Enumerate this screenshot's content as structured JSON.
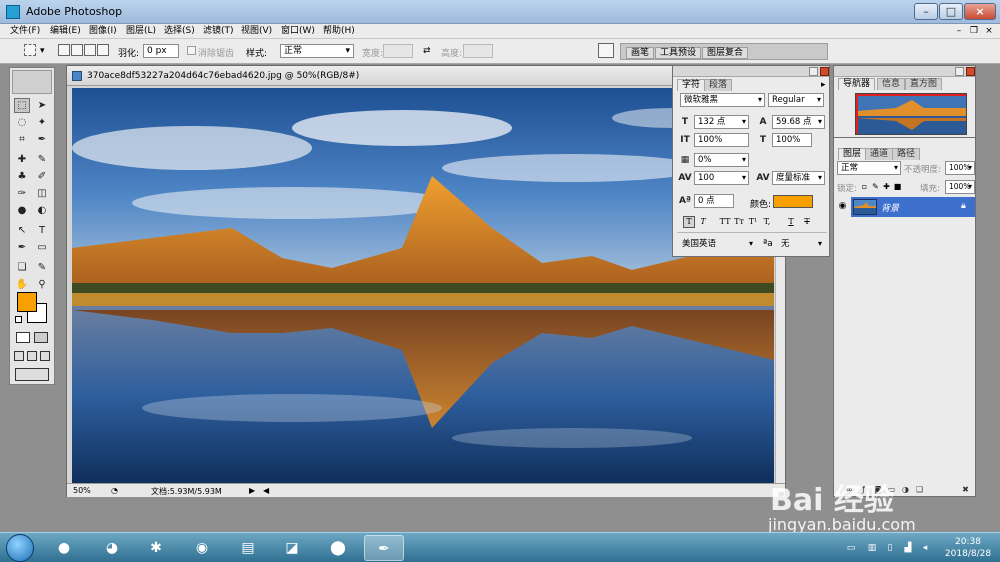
{
  "window": {
    "title": "Adobe Photoshop",
    "min": "–",
    "max": "□",
    "close": "×"
  },
  "menu": [
    "文件(F)",
    "编辑(E)",
    "图像(I)",
    "图层(L)",
    "选择(S)",
    "滤镜(T)",
    "视图(V)",
    "窗口(W)",
    "帮助(H)"
  ],
  "doc_controls": {
    "min": "–",
    "restore": "❐",
    "close": "×"
  },
  "options": {
    "feather_label": "羽化:",
    "feather_value": "0 px",
    "antialias_label": "消除锯齿",
    "style_label": "样式:",
    "style_value": "正常",
    "width_label": "宽度:",
    "height_label": "高度:",
    "swap": "⇄",
    "well_tabs": [
      "画笔",
      "工具预设",
      "图层复合"
    ]
  },
  "toolbox": {
    "tools": [
      "⬚",
      "➤",
      "◌",
      "✦",
      "⌗",
      "✒",
      "✚",
      "✎",
      "♣",
      "✐",
      "✑",
      "✎",
      "◫",
      "▮",
      "●",
      "◐",
      "↖",
      "T",
      "✒",
      "▭",
      "❏",
      "✋",
      "✋",
      "⚲"
    ],
    "fg_color": "#f7a000",
    "bg_color": "#ffffff"
  },
  "document": {
    "title": "370ace8df53227a204d64c76ebad4620.jpg @ 50%(RGB/8#)",
    "zoom": "50%",
    "doc_info": "文档:5.93M/5.93M"
  },
  "character": {
    "tabs": [
      "字符",
      "段落"
    ],
    "font_family": "微软雅黑",
    "font_style": "Regular",
    "size": "132 点",
    "leading": "59.68 点",
    "vscale": "100%",
    "hscale": "100%",
    "kerning_pct": "0%",
    "tracking": "100",
    "kerning": "度量标准",
    "baseline": "0 点",
    "color_label": "颜色:",
    "color": "#f7a000",
    "format_buttons": [
      "T",
      "T",
      "TT",
      "Tт",
      "T¹",
      "T,",
      "T",
      "T"
    ],
    "language": "美国英语",
    "aa_label": "ªa",
    "aa_value": "无"
  },
  "navigator": {
    "tabs": [
      "导航器",
      "信息",
      "直方图"
    ]
  },
  "layers": {
    "tabs": [
      "图层",
      "通道",
      "路径"
    ],
    "blend_mode": "正常",
    "opacity_label": "不透明度:",
    "opacity": "100%",
    "lock_label": "锁定:",
    "fill_label": "填充:",
    "fill": "100%",
    "layer_name": "背景"
  },
  "watermark": {
    "logo": "Bai 经验",
    "url": "jingyan.baidu.com"
  },
  "taskbar": {
    "time": "20:38",
    "date": "2018/8/28"
  }
}
